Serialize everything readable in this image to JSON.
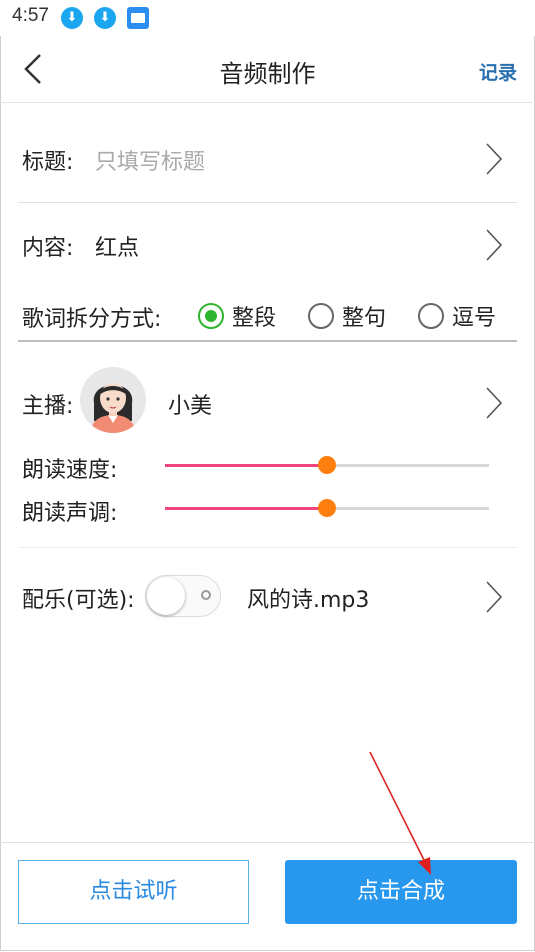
{
  "status_bar": {
    "time": "4:57"
  },
  "header": {
    "title": "音频制作",
    "record_label": "记录"
  },
  "form": {
    "title_label": "标题:",
    "title_placeholder": "只填写标题",
    "content_label": "内容:",
    "content_value": "红点",
    "lyric_split_label": "歌词拆分方式:",
    "lyric_split_options": [
      "整段",
      "整句",
      "逗号"
    ],
    "lyric_split_selected": "整段",
    "anchor_label": "主播:",
    "anchor_name": "小美",
    "speed_label": "朗读速度:",
    "speed_value": 0.5,
    "pitch_label": "朗读声调:",
    "pitch_value": 0.5,
    "music_label": "配乐(可选):",
    "music_enabled": false,
    "music_file": "风的诗.mp3"
  },
  "buttons": {
    "listen_label": "点击试听",
    "compose_label": "点击合成"
  },
  "colors": {
    "accent": "#2898ee",
    "radio_on": "#2fb42f",
    "slider_fill": "#f0457a",
    "slider_knob": "#ff7f0e",
    "annotation_arrow": "#e02020"
  }
}
